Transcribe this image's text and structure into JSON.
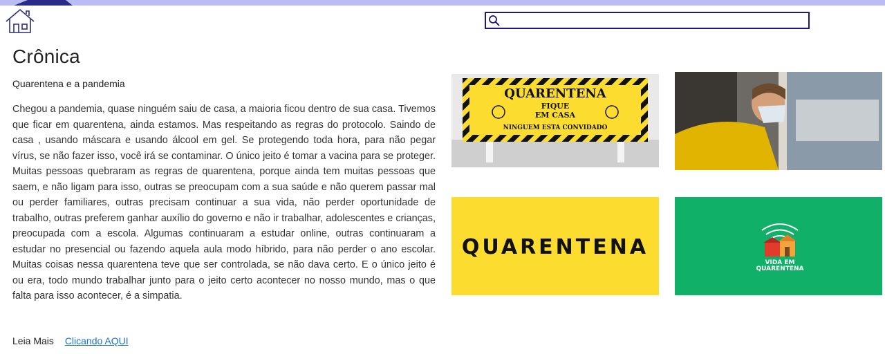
{
  "header": {
    "search": {
      "placeholder": "",
      "value": ""
    }
  },
  "article": {
    "title": "Crônica",
    "subtitle": "Quarentena e a pandemia",
    "body": "Chegou a pandemia, quase ninguém saiu de casa, a maioria ficou dentro de sua casa. Tivemos que ficar em quarentena, ainda estamos. Mas respeitando as regras do protocolo. Saindo de casa , usando máscara e usando álcool em gel. Se protegendo toda hora, para não pegar vírus, se não fazer isso, você irá se contaminar. O único jeito é tomar a vacina para se proteger. Muitas pessoas quebraram as regras de quarentena, porque ainda tem muitas pessoas que saem, e não ligam para isso, outras se preocupam com a sua saúde e não querem passar mal ou perder familiares, outras precisam continuar a sua vida, não perder oportunidade de trabalho, outras preferem ganhar auxílio do governo e não ir trabalhar, adolescentes e crianças, preocupada com a escola. Algumas continuaram a estudar online, outras continuaram a estudar no presencial ou fazendo aquela aula modo híbrido, para não perder o ano escolar. Muitas coisas nessa quarentena teve que ser controlada, se não dava certo. E o único jeito é ou era, todo mundo trabalhar junto para o jeito certo acontecer no nosso mundo, mas o que falta para isso acontecer, é a simpatia.",
    "read_more_label": "Leia Mais",
    "read_more_link": "Clicando AQUI"
  },
  "images": {
    "img1": {
      "line1": "QUARENTENA",
      "line2": "FIQUE",
      "line3": "EM CASA",
      "line4": "NINGUEM ESTA CONVIDADO"
    },
    "img3": {
      "text": "QUARENTENA"
    },
    "img4": {
      "line1": "VIDA EM",
      "line2": "QUARENTENA"
    }
  },
  "colors": {
    "topbar": "#b9bdf3",
    "search_border": "#1f1877",
    "link": "#1a6fd6",
    "yellow": "#fcdc2e",
    "green": "#10b068"
  }
}
